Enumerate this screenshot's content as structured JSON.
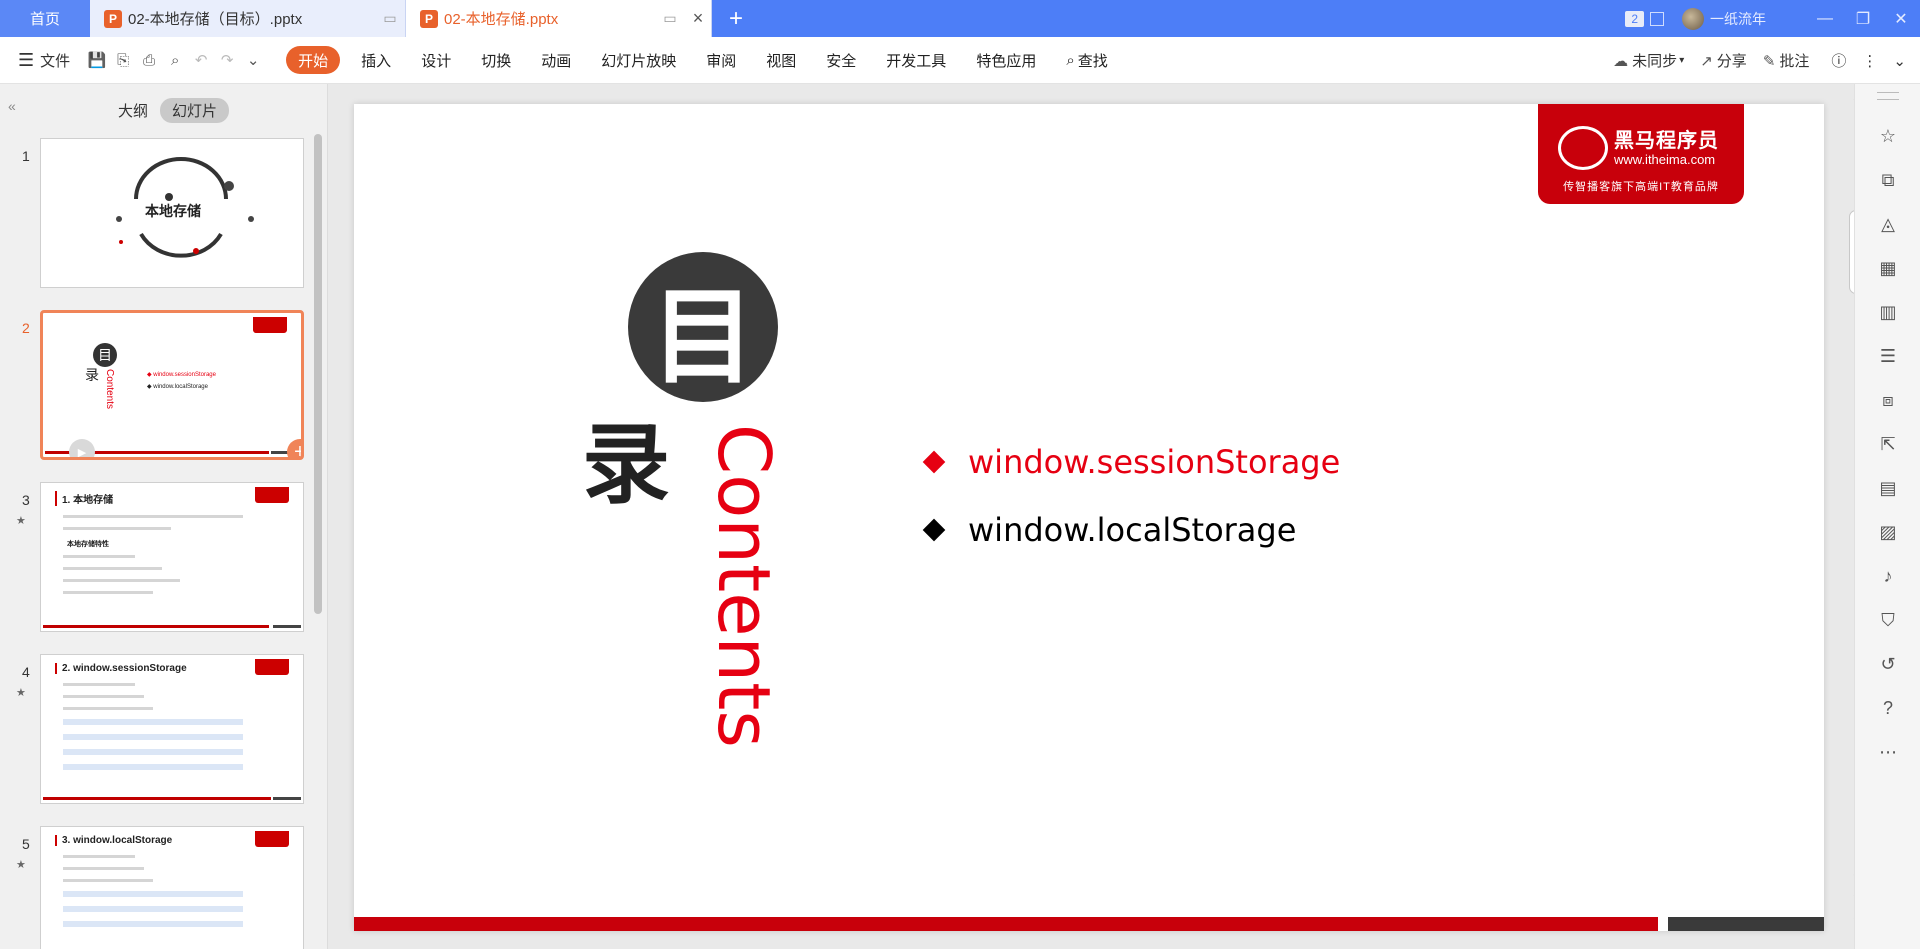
{
  "tabs": {
    "home": "首页",
    "doc1_title": "02-本地存储（目标）.pptx",
    "doc2_title": "02-本地存储.pptx",
    "new_tab": "+"
  },
  "titlebar": {
    "window_count": "2",
    "username": "一纸流年"
  },
  "ribbon": {
    "file": "文件",
    "tabs": [
      "开始",
      "插入",
      "设计",
      "切换",
      "动画",
      "幻灯片放映",
      "审阅",
      "视图",
      "安全",
      "开发工具",
      "特色应用",
      "查找"
    ],
    "sync": "未同步",
    "share": "分享",
    "comment": "批注"
  },
  "left_panel": {
    "tab_outline": "大纲",
    "tab_slides": "幻灯片",
    "thumbnails": [
      {
        "num": "1",
        "title": "本地存储"
      },
      {
        "num": "2",
        "title": "目录",
        "item1": "window.sessionStorage",
        "item2": "window.localStorage",
        "vertical": "Contents",
        "lu": "录",
        "mu": "目"
      },
      {
        "num": "3",
        "title": "1. 本地存储",
        "subtitle": "本地存储特性"
      },
      {
        "num": "4",
        "title": "2. window.sessionStorage"
      },
      {
        "num": "5",
        "title": "3. window.localStorage"
      }
    ]
  },
  "slide": {
    "logo_name": "黑马程序员",
    "logo_url": "www.itheima.com",
    "logo_slogan": "传智播客旗下高端IT教育品牌",
    "mu": "目",
    "lu": "录",
    "contents": "Contents",
    "agenda": [
      {
        "text": "window.sessionStorage",
        "color": "#e60012"
      },
      {
        "text": "window.localStorage",
        "color": "#000000"
      }
    ]
  },
  "colors": {
    "tabbar": "#4d7ef7",
    "accent": "#e8612b",
    "brand_red": "#c8000b"
  }
}
